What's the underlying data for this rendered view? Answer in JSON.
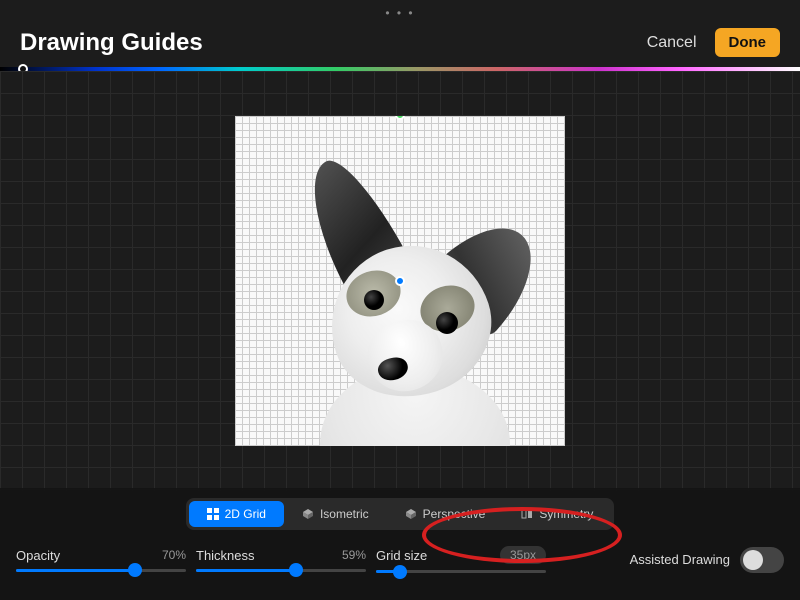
{
  "header": {
    "title": "Drawing Guides",
    "cancel": "Cancel",
    "done": "Done"
  },
  "tabs": {
    "grid2d": "2D Grid",
    "isometric": "Isometric",
    "perspective": "Perspective",
    "symmetry": "Symmetry"
  },
  "controls": {
    "opacity": {
      "label": "Opacity",
      "value": "70%",
      "pct": 70
    },
    "thickness": {
      "label": "Thickness",
      "value": "59%",
      "pct": 59
    },
    "gridsize": {
      "label": "Grid size",
      "value": "35px",
      "pct": 14
    },
    "assisted": {
      "label": "Assisted Drawing",
      "on": false
    }
  }
}
